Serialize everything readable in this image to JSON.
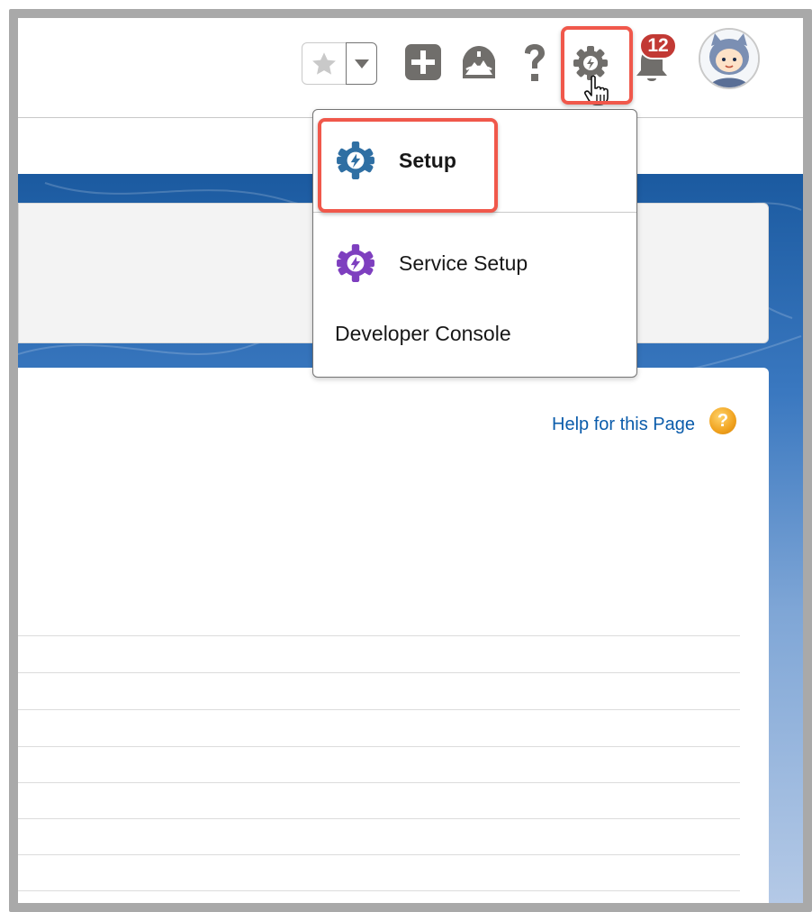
{
  "header": {
    "favorites_star_icon": "star-icon",
    "favorites_dropdown_icon": "chevron-down-icon",
    "global_actions_icon": "plus-icon",
    "trailhead_icon": "trailhead-icon",
    "help_icon": "question-icon",
    "setup_icon": "gear-icon",
    "notifications": {
      "icon": "bell-icon",
      "count": "12"
    },
    "avatar_icon": "avatar-icon"
  },
  "setup_menu": {
    "items": [
      {
        "label": "Setup",
        "icon": "setup-gear-icon",
        "color": "#2f6fa3"
      },
      {
        "label": "Service Setup",
        "icon": "service-setup-gear-icon",
        "color": "#7e3fbf"
      },
      {
        "label": "Developer Console"
      }
    ]
  },
  "page": {
    "help_link": "Help for this Page",
    "help_badge": "?"
  },
  "colors": {
    "highlight": "#f0584b",
    "badge": "#c23934",
    "link": "#0b5cab"
  }
}
